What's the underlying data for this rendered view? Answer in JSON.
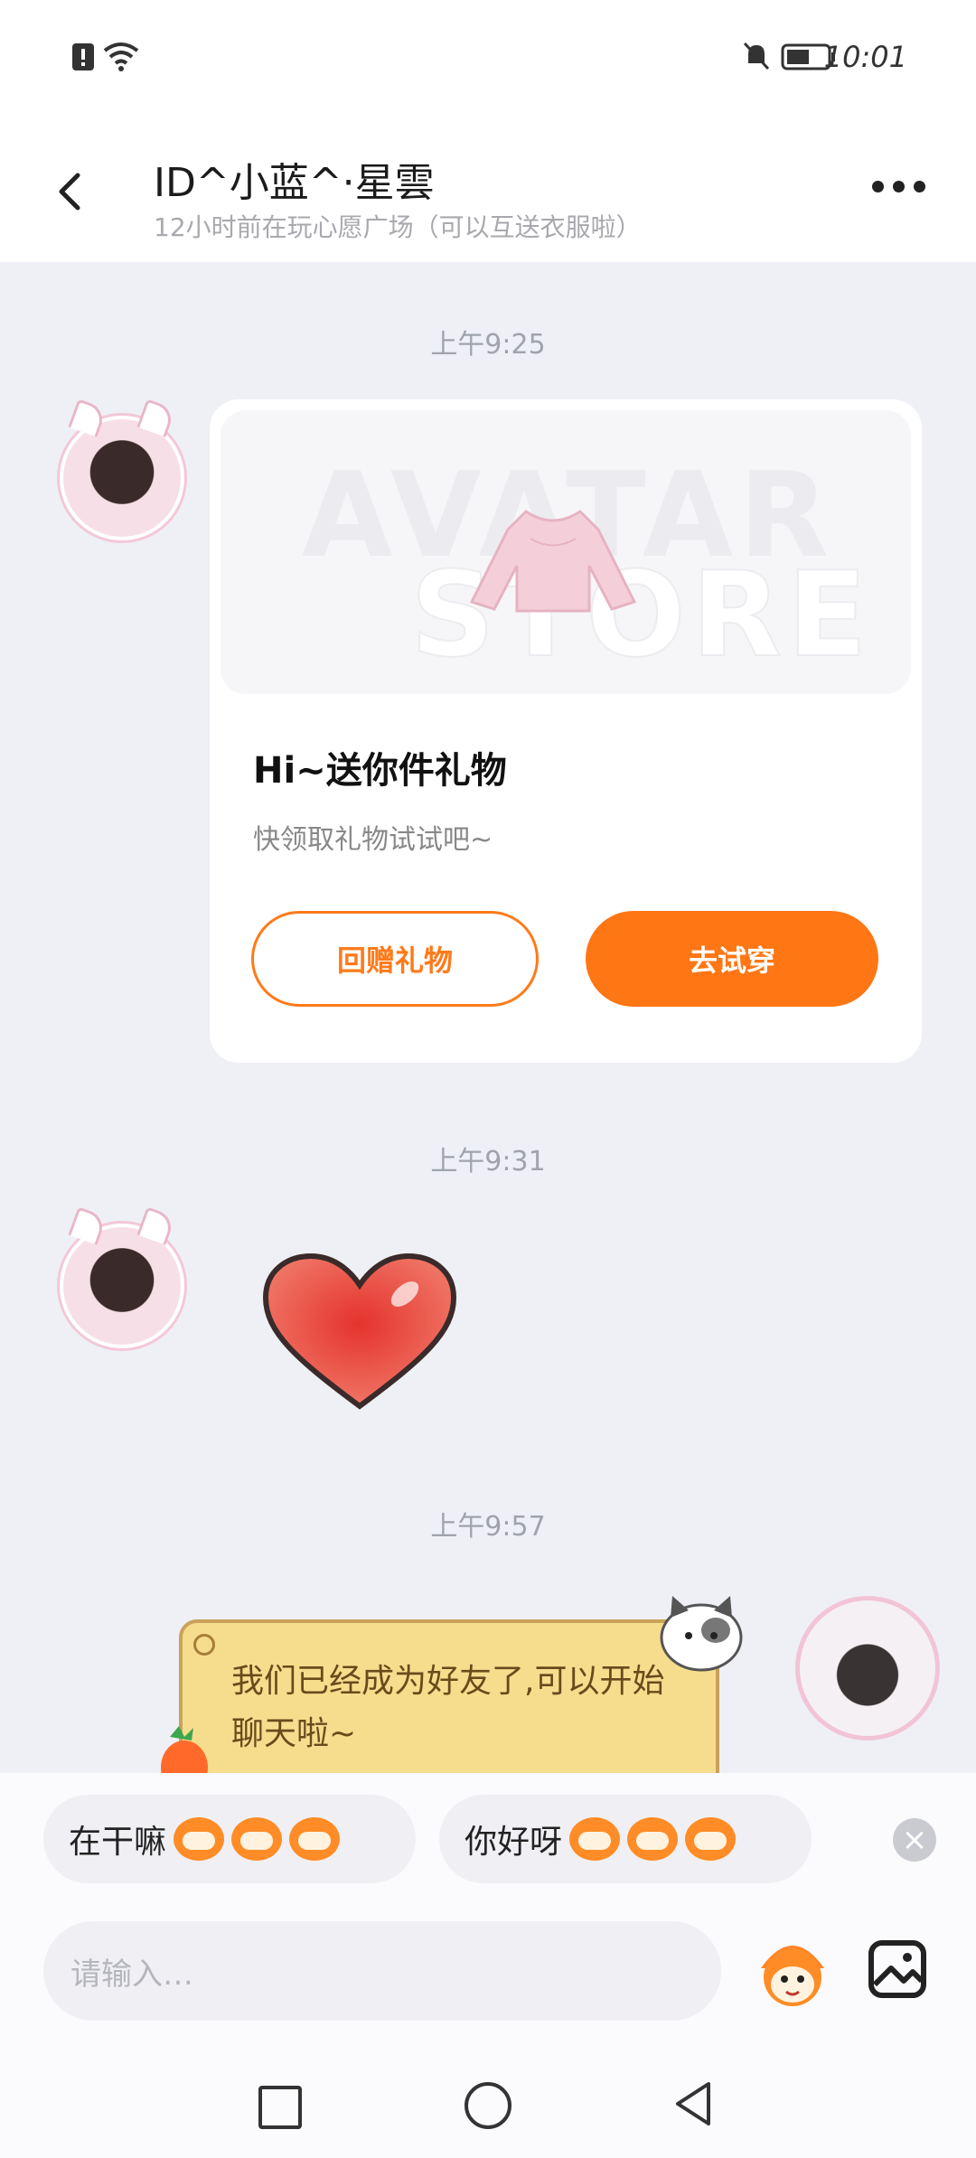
{
  "status_bar": {
    "time": "10:01"
  },
  "header": {
    "title": "ID^小蓝^·星雲",
    "subtitle": "12小时前在玩心愿广场（可以互送衣服啦）"
  },
  "messages": {
    "ts1": "上午9:25",
    "ts2": "上午9:31",
    "ts3": "上午9:57",
    "gift_card": {
      "watermark_1": "AVATAR",
      "watermark_2": "STORE",
      "title": "Hi~送你件礼物",
      "desc": "快领取礼物试试吧~",
      "btn_return": "回赠礼物",
      "btn_try": "去试穿"
    },
    "system_bubble": "我们已经成为好友了,可以开始聊天啦~"
  },
  "quick_replies": [
    {
      "label": "在干嘛"
    },
    {
      "label": "你好呀"
    }
  ],
  "composer": {
    "placeholder": "请输入…"
  },
  "colors": {
    "accent": "#ff7614",
    "bubble": "#f6dd8d"
  },
  "icons": [
    "back-icon",
    "more-icon",
    "heart-sticker",
    "close-icon",
    "sticker-icon",
    "image-icon"
  ]
}
